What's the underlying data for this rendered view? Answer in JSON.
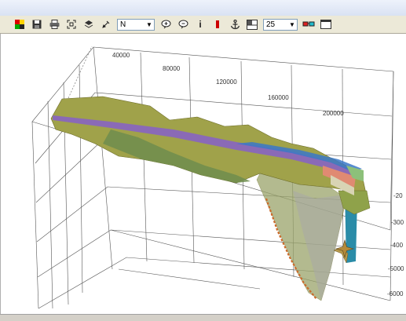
{
  "toolbar": {
    "direction_select_value": "N",
    "size_select_value": "25",
    "info_glyph": "i",
    "buttons": [
      "color-palette-icon",
      "save-icon",
      "print-icon",
      "fit-view-icon",
      "layers-icon",
      "pick-icon",
      "direction-select",
      "zoom-in-icon",
      "zoom-out-icon",
      "info-icon",
      "marker-icon",
      "anchor-icon",
      "panel-icon",
      "size-select",
      "stereo-glasses-icon",
      "window-icon"
    ]
  },
  "scene": {
    "x_ticks": [
      "40000",
      "80000",
      "120000",
      "160000",
      "200000"
    ],
    "z_ticks": [
      "-20",
      "-300",
      "-400",
      "-5000",
      "-6000"
    ]
  }
}
